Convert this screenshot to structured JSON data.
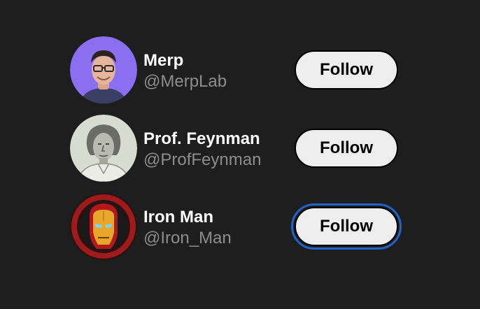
{
  "users": [
    {
      "name": "Merp",
      "handle": "@MerpLab",
      "avatar": "person-photo",
      "follow_label": "Follow",
      "focused": false
    },
    {
      "name": "Prof. Feynman",
      "handle": "@ProfFeynman",
      "avatar": "sketch-portrait",
      "follow_label": "Follow",
      "focused": false
    },
    {
      "name": "Iron Man",
      "handle": "@Iron_Man",
      "avatar": "iron-man-helmet",
      "follow_label": "Follow",
      "focused": true
    }
  ],
  "colors": {
    "background": "#1e1e1e",
    "name_text": "#ffffff",
    "handle_text": "#8d8d8d",
    "button_fill": "#eeeeee",
    "focus_ring": "#1f62c9"
  }
}
